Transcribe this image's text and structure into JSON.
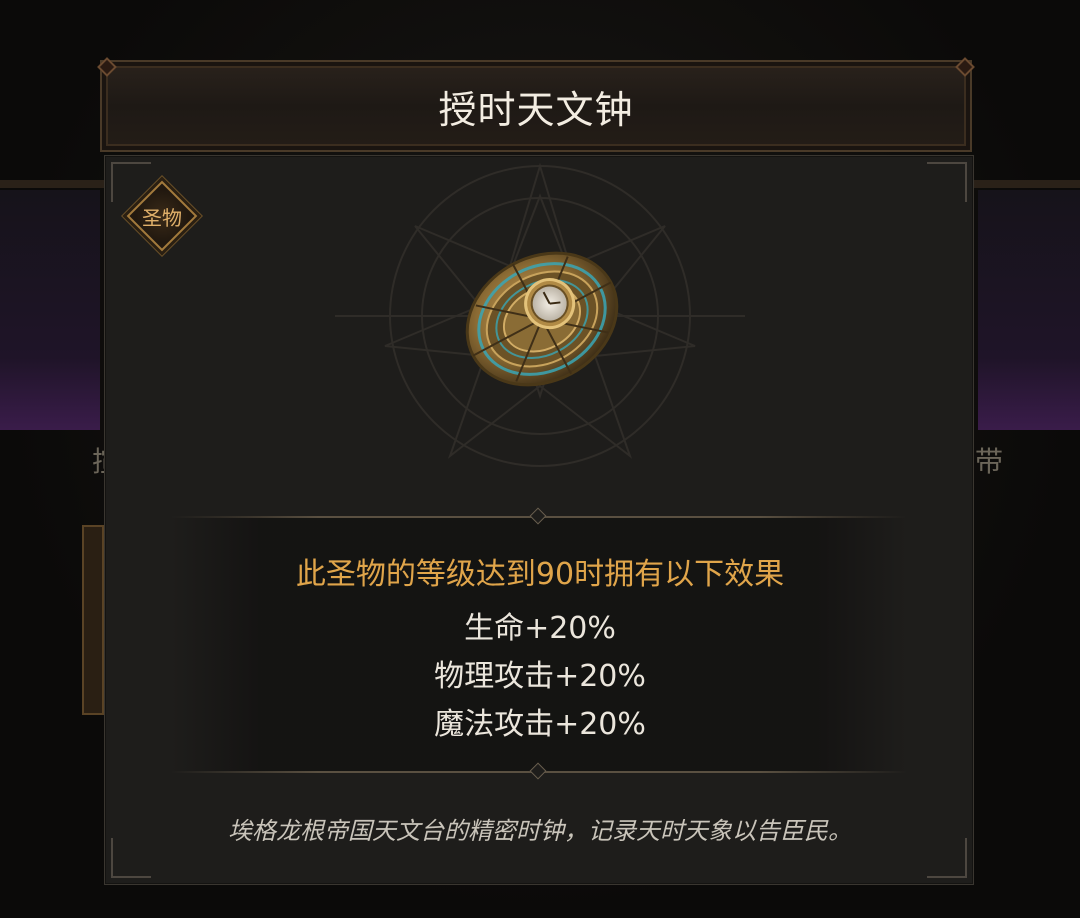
{
  "dialog": {
    "title": "授时天文钟",
    "badge_label": "圣物",
    "item_icon": "astronomical-clock-relic",
    "effects": {
      "header": "此圣物的等级达到90时拥有以下效果",
      "lines": [
        "生命+20%",
        "物理攻击+20%",
        "魔法攻击+20%"
      ]
    },
    "description": "埃格龙根帝国天文台的精密时钟，记录天时天象以告臣民。"
  },
  "background": {
    "left_glyph": "揎",
    "right_glyph": "带"
  },
  "colors": {
    "accent_gold": "#e0a54a",
    "title_text": "#f3ede2",
    "panel_bg": "#1e1d1b"
  }
}
